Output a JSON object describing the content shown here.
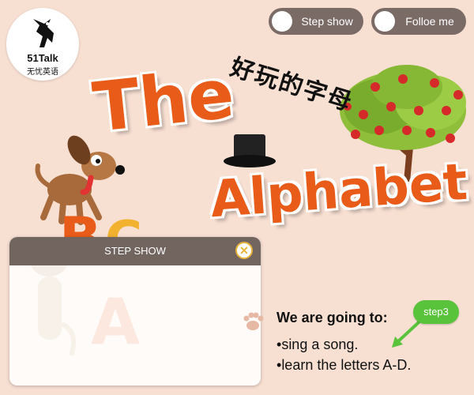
{
  "logo": {
    "brand": "51Talk",
    "subtitle": "无忧英语"
  },
  "toggles": [
    {
      "label": "Step show"
    },
    {
      "label": "Folloe me"
    }
  ],
  "title": {
    "chinese": "好玩的字母",
    "word1": "The",
    "word2": "Alphabet"
  },
  "panel": {
    "title": "STEP SHOW",
    "close_symbol": "✕"
  },
  "goals": {
    "heading": "We are going to:",
    "items": [
      "sing a song.",
      "learn the letters A-D."
    ],
    "bullet": "•"
  },
  "step_badge": {
    "label": "step3"
  },
  "colors": {
    "background": "#f7dfd2",
    "title_orange": "#e95b18",
    "toggle": "#7b6b66",
    "panel_header": "#726560",
    "badge_green": "#59c33b",
    "close_ring": "#e8b33a"
  }
}
